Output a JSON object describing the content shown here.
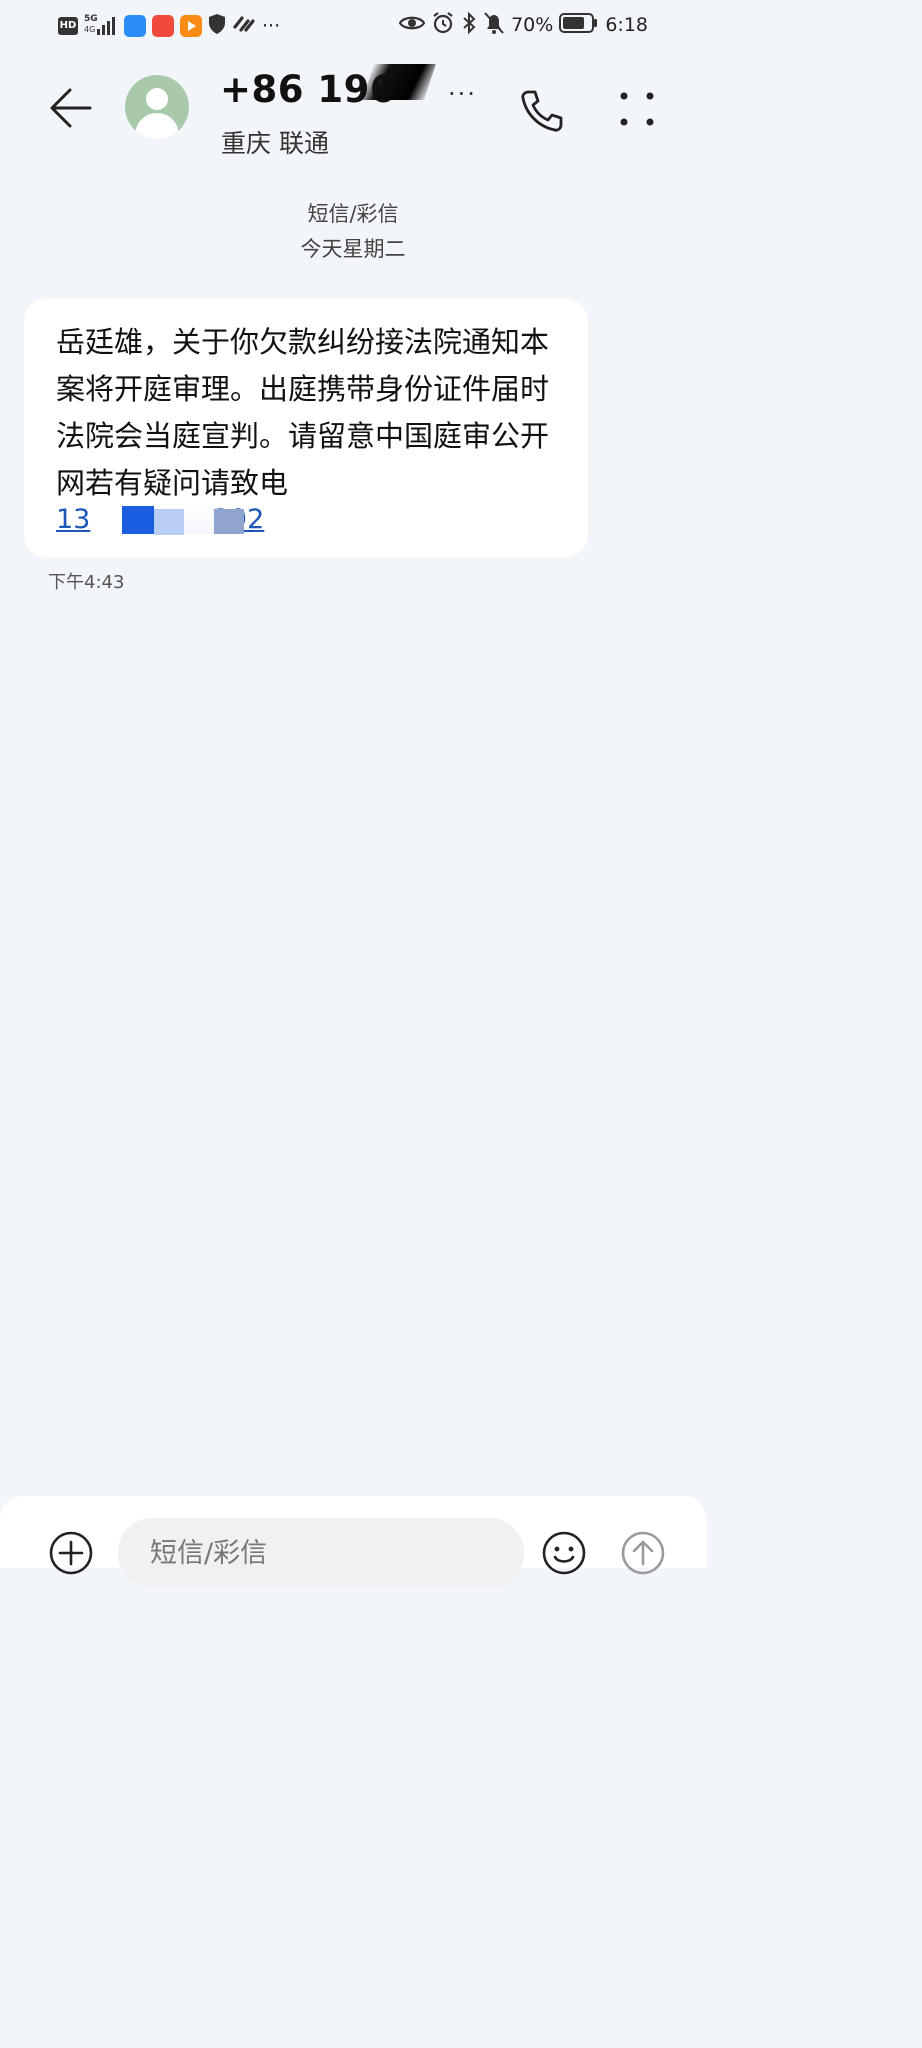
{
  "status_bar": {
    "hd": "HD",
    "net_5g": "5G",
    "net_4g": "4G",
    "battery": "70%",
    "time": "6:18",
    "more": "···"
  },
  "header": {
    "number": "+86 196",
    "location_carrier": "重庆 联通",
    "more": "···"
  },
  "thread": {
    "type": "短信/彩信",
    "date": "今天星期二"
  },
  "message": {
    "text": "岳廷雄，关于你欠款纠纷接法院通知本案将开庭审理。出庭携带身份证件届时法院会当庭宣判。请留意中国庭审公开网若有疑问请致电",
    "link_prefix": "13",
    "link_suffix": "67392",
    "time": "下午4:43"
  },
  "composer": {
    "placeholder": "短信/彩信"
  },
  "icons": {
    "back": "back-arrow-icon",
    "phone": "phone-icon",
    "menu": "four-dots-menu-icon",
    "add": "add-icon",
    "emoji": "emoji-icon",
    "send": "send-icon"
  }
}
